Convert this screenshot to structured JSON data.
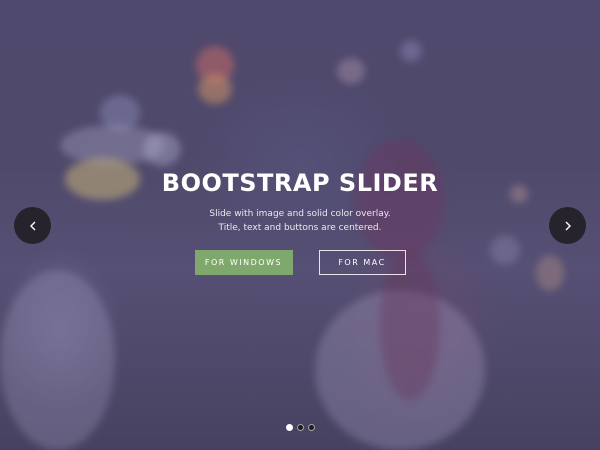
{
  "slider": {
    "title": "BOOTSTRAP SLIDER",
    "subtitle_line1": "Slide with image and solid color overlay.",
    "subtitle_line2": "Title, text and buttons are centered.",
    "buttons": {
      "windows_label": "FOR WINDOWS",
      "mac_label": "FOR MAC"
    },
    "prev_icon": "chevron-left-icon",
    "next_icon": "chevron-right-icon",
    "indicators": {
      "count": 3,
      "active_index": 0
    }
  },
  "colors": {
    "overlay": "#5a5082",
    "primary_button": "#7fa86c",
    "arrow_background": "#26232c",
    "text": "#ffffff"
  }
}
